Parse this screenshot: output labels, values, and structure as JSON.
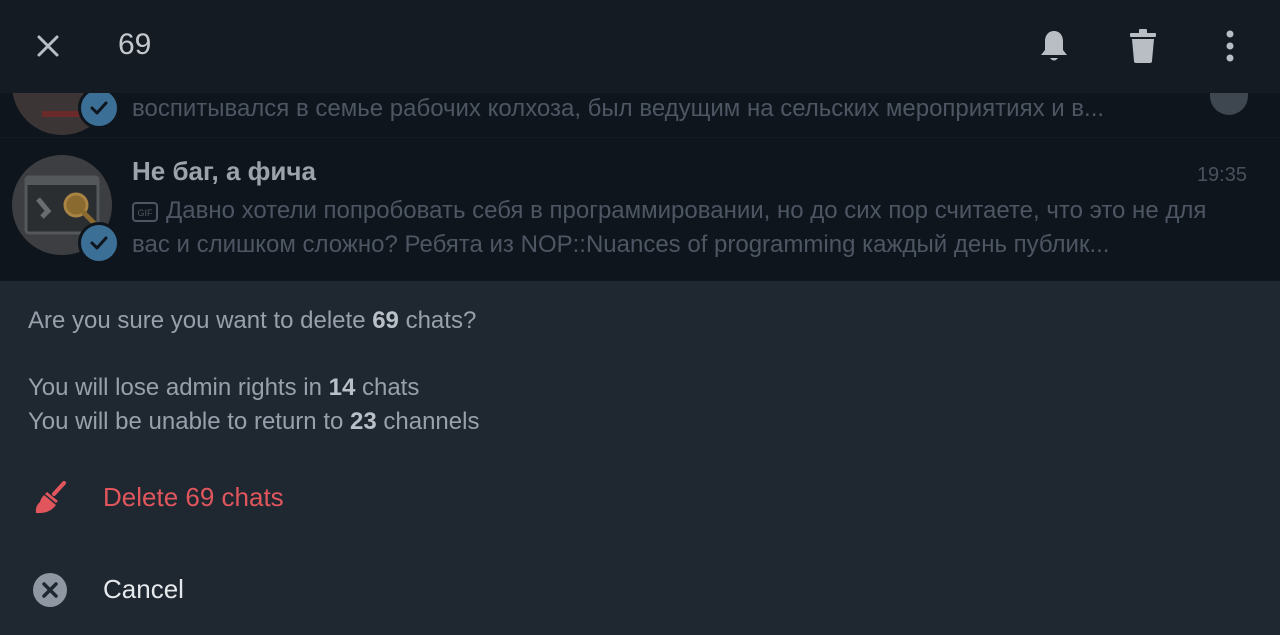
{
  "topbar": {
    "selected_count": "69",
    "icons": {
      "close": "close-icon",
      "mute": "bell-icon",
      "delete": "trash-icon",
      "more": "more-vertical-icon"
    }
  },
  "chats": [
    {
      "preview": "воспитывался в семье рабочих колхоза, был ведущим на сельских мероприятиях и в...",
      "verified": true
    },
    {
      "title": "Не баг, а фича",
      "time": "19:35",
      "preview_media": "GIF",
      "preview": "Давно хотели попробовать себя в программировании, но до сих пор считаете, что это не для вас и слишком сложно? Ребята из NOP::Nuances of programming каждый день публик...",
      "verified": true
    }
  ],
  "dialog": {
    "question_prefix": "Are you sure you want to delete ",
    "question_count": "69",
    "question_suffix": " chats?",
    "admin_prefix": "You will lose admin rights in ",
    "admin_count": "14",
    "admin_suffix": " chats",
    "return_prefix": "You will be unable to return to ",
    "return_count": "23",
    "return_suffix": " channels",
    "delete_label": "Delete 69 chats",
    "cancel_label": "Cancel"
  },
  "colors": {
    "danger": "#e0565c",
    "sheet_bg": "#1f2731",
    "topbar_bg": "#151b23",
    "verified_badge": "#3c6f96"
  }
}
